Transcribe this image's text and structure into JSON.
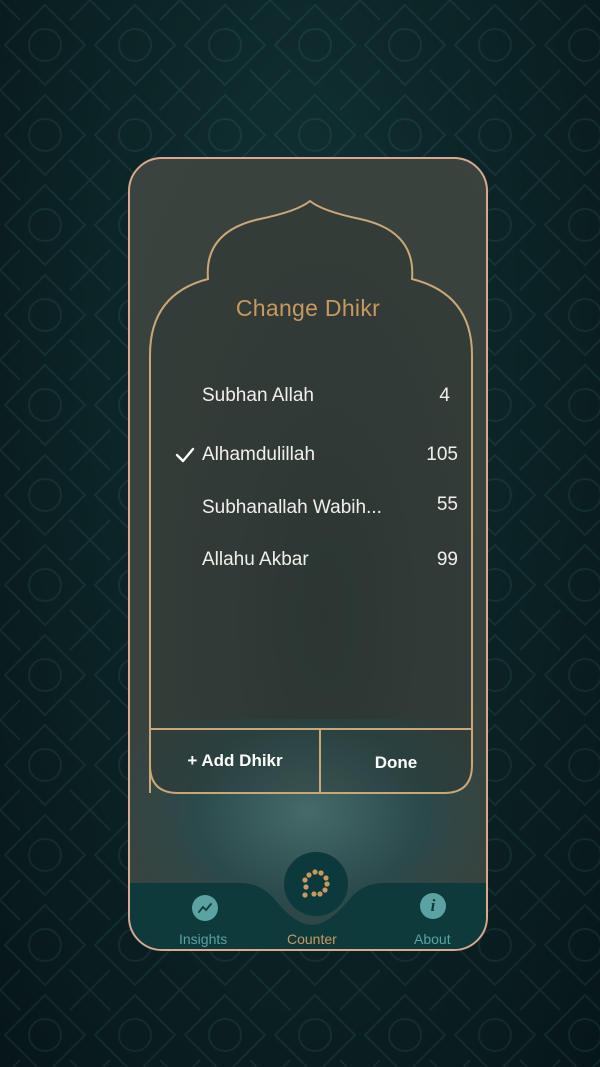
{
  "modal": {
    "title": "Change Dhikr",
    "items": [
      {
        "name": "Subhan Allah",
        "count": "4",
        "selected": false
      },
      {
        "name": "Alhamdulillah",
        "count": "105",
        "selected": true
      },
      {
        "name": "Subhanallah Wabih...",
        "count": "55",
        "selected": false
      },
      {
        "name": "Allahu Akbar",
        "count": "99",
        "selected": false
      }
    ],
    "add_label": "+ Add Dhikr",
    "done_label": "Done"
  },
  "nav": {
    "insights_label": "Insights",
    "counter_label": "Counter",
    "about_label": "About",
    "about_icon_glyph": "i"
  },
  "colors": {
    "accent_gold": "#c8995f",
    "frame_border": "#d8a88f",
    "nav_teal": "#5aa3a2",
    "nav_bar": "#0f3a3c"
  },
  "icons": [
    "checkmark-icon",
    "insights-chart-icon",
    "tasbih-beads-icon",
    "info-icon"
  ]
}
